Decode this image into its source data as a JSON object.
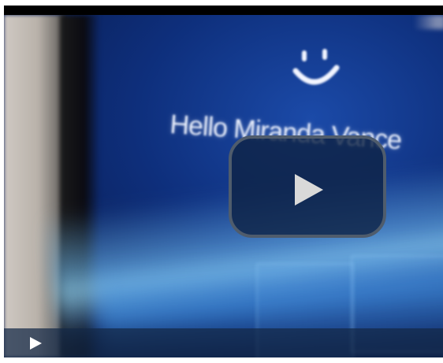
{
  "video": {
    "greeting_text": "Hello Miranda Vance",
    "background_accent": "#0e2f7c"
  },
  "controls": {
    "big_play_icon": "play-icon",
    "control_play_icon": "play-icon",
    "bar_color": "#142846"
  }
}
